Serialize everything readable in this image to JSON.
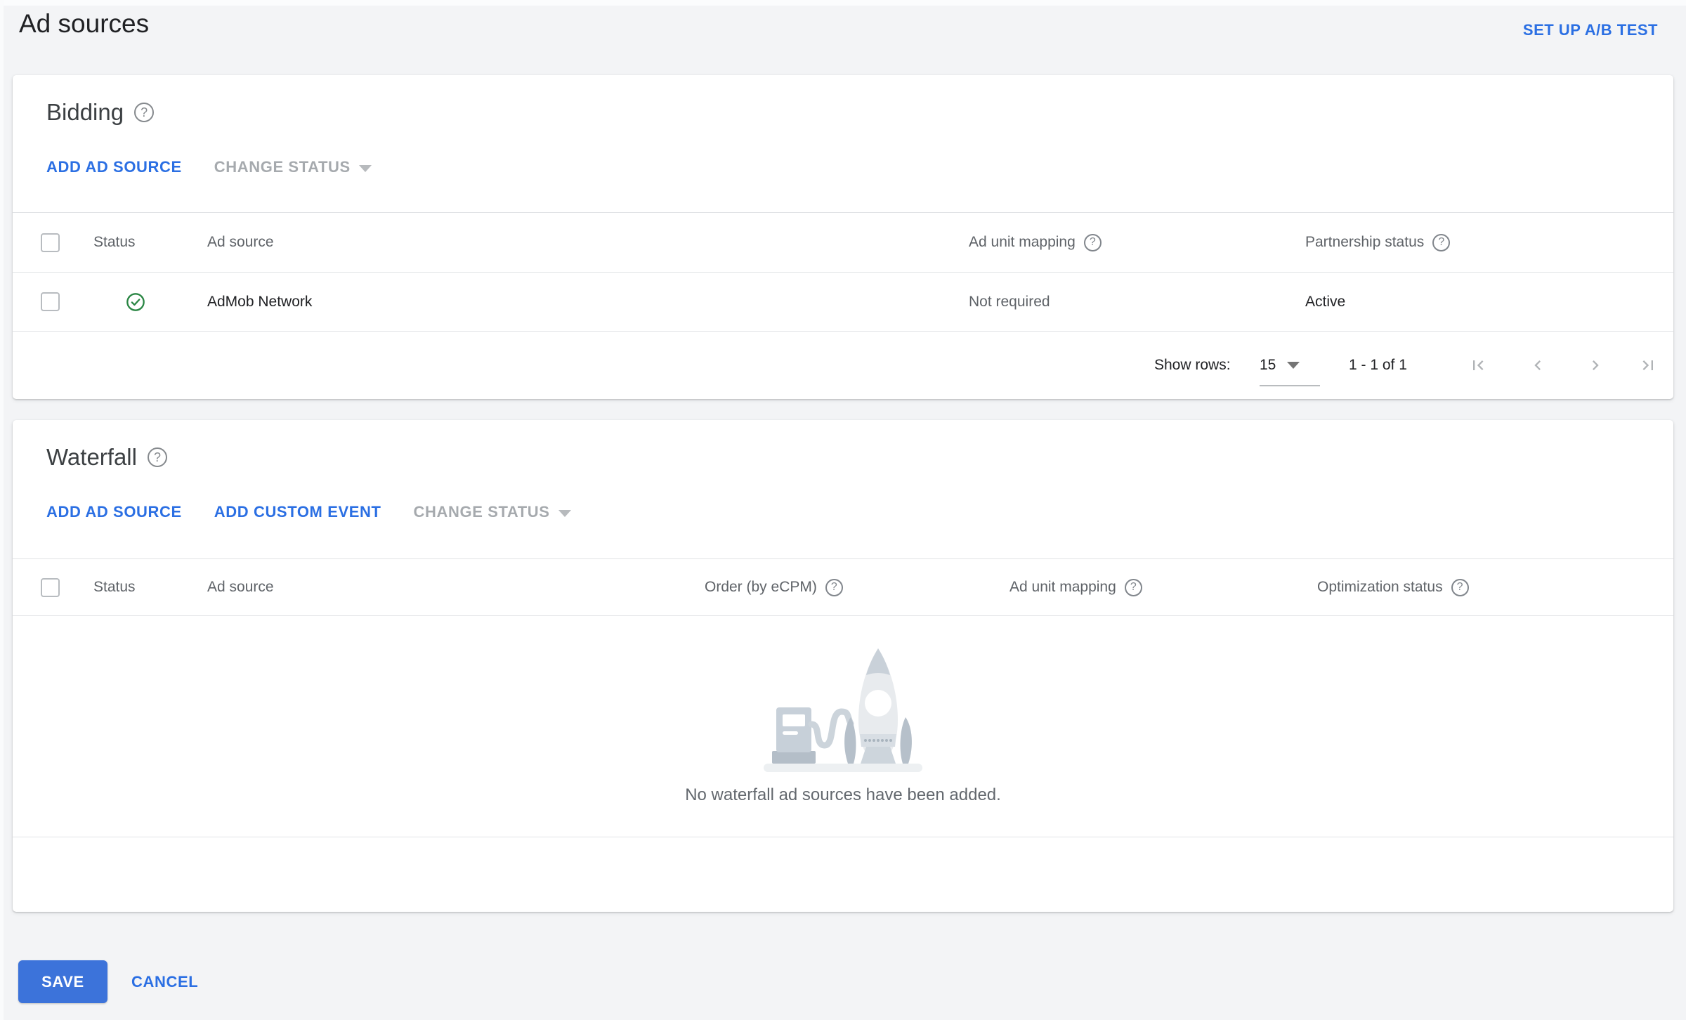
{
  "page": {
    "title": "Ad sources",
    "ab_test_label": "SET UP A/B TEST"
  },
  "bidding": {
    "title": "Bidding",
    "actions": {
      "add_ad_source": "ADD AD SOURCE",
      "change_status": "CHANGE STATUS"
    },
    "columns": {
      "status": "Status",
      "ad_source": "Ad source",
      "ad_unit_mapping": "Ad unit mapping",
      "partnership_status": "Partnership status"
    },
    "rows": [
      {
        "status_icon": "check-circle-green",
        "ad_source": "AdMob Network",
        "ad_unit_mapping": "Not required",
        "partnership_status": "Active"
      }
    ],
    "pagination": {
      "show_rows_label": "Show rows:",
      "rows_per_page": "15",
      "range": "1 - 1 of 1"
    }
  },
  "waterfall": {
    "title": "Waterfall",
    "actions": {
      "add_ad_source": "ADD AD SOURCE",
      "add_custom_event": "ADD CUSTOM EVENT",
      "change_status": "CHANGE STATUS"
    },
    "columns": {
      "status": "Status",
      "ad_source": "Ad source",
      "order": "Order (by eCPM)",
      "ad_unit_mapping": "Ad unit mapping",
      "optimization_status": "Optimization status"
    },
    "empty_message": "No waterfall ad sources have been added."
  },
  "footer": {
    "save": "SAVE",
    "cancel": "CANCEL"
  },
  "colors": {
    "link_blue": "#2b6fe3",
    "button_blue": "#3c73da",
    "success_green": "#2a8644",
    "disabled_gray": "#a6aaae"
  }
}
